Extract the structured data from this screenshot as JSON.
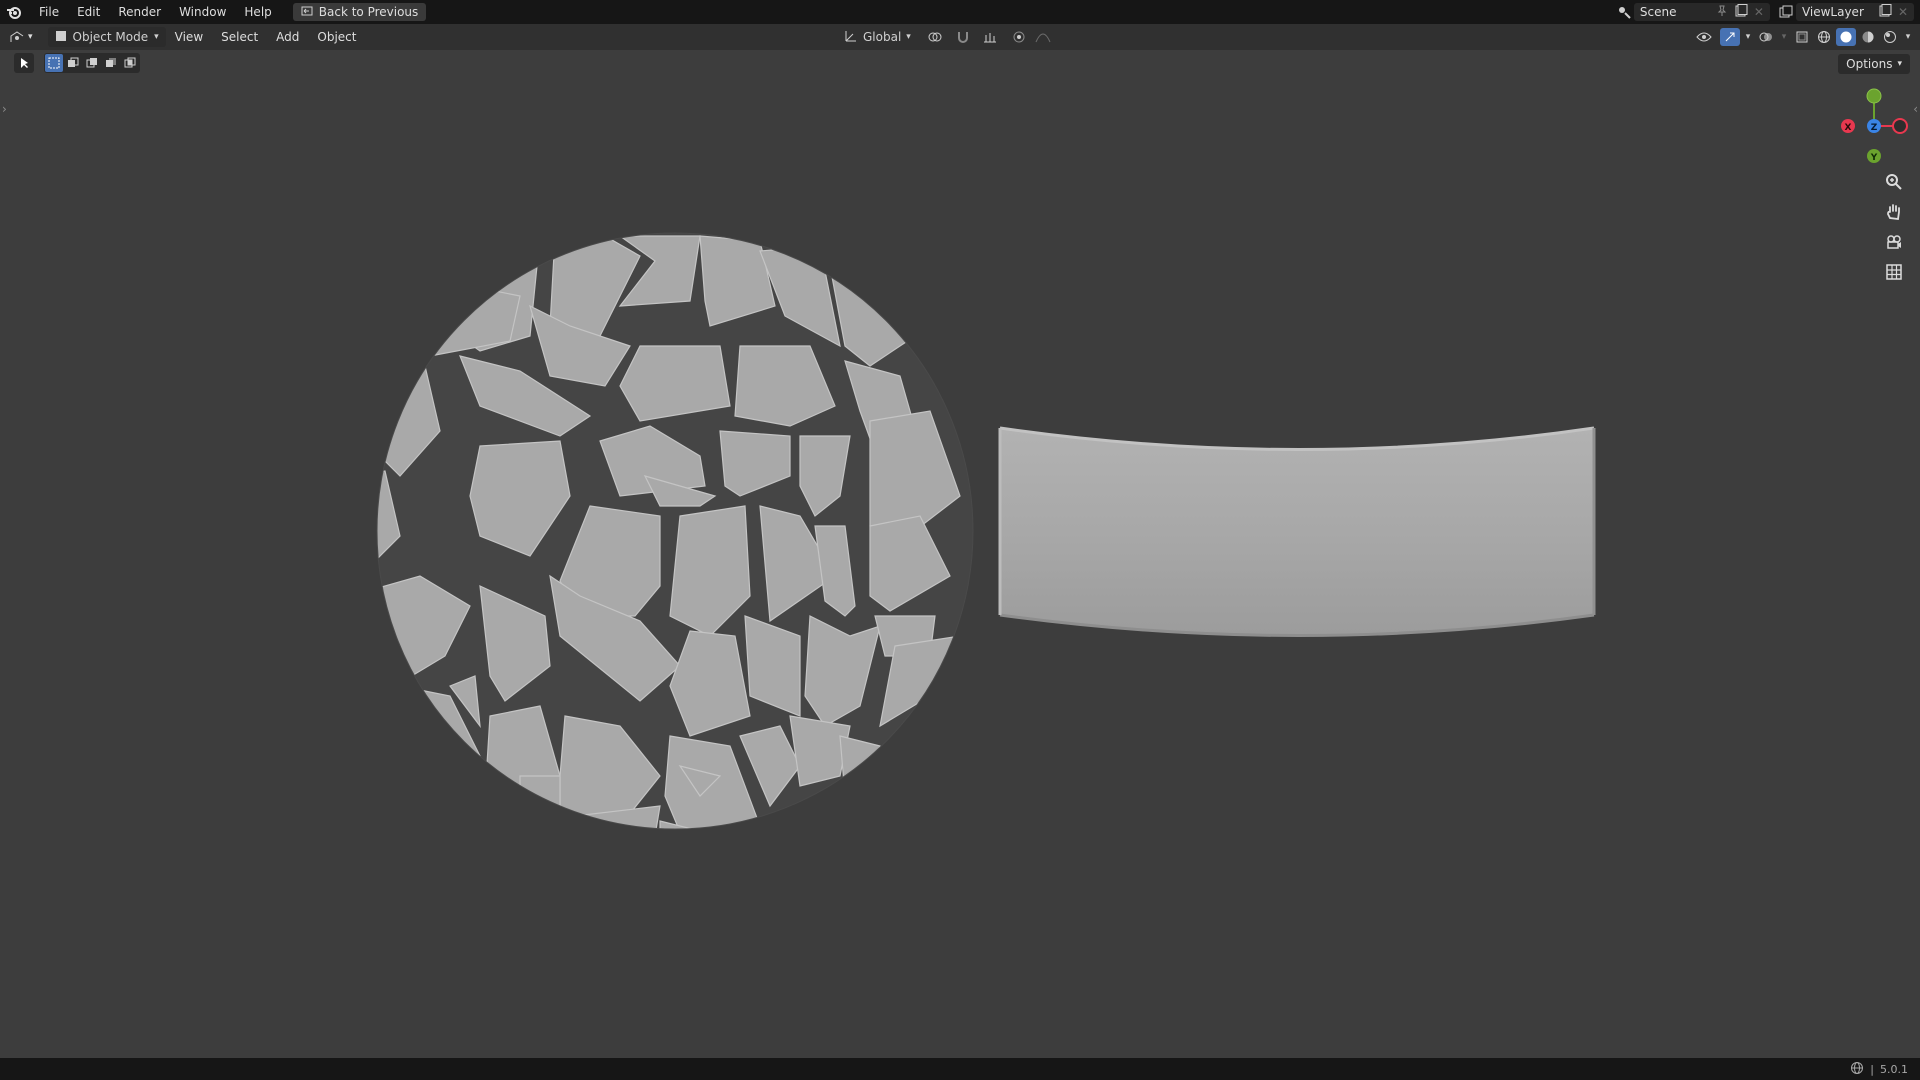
{
  "menu": {
    "file": "File",
    "edit": "Edit",
    "render": "Render",
    "window": "Window",
    "help": "Help",
    "back_to_previous": "Back to Previous"
  },
  "scene": {
    "label": "Scene"
  },
  "view_layer": {
    "label": "ViewLayer"
  },
  "header": {
    "mode": "Object Mode",
    "view": "View",
    "select": "Select",
    "add": "Add",
    "object": "Object",
    "transform_orientation": "Global"
  },
  "options_label": "Options",
  "gizmo": {
    "x": "X",
    "y": "Y",
    "z": "Z"
  },
  "colors": {
    "accent": "#4772b3",
    "axis_x": "#e8384f",
    "axis_y": "#6ba32e",
    "axis_z": "#3a84e6",
    "background": "#3d3d3d",
    "mesh": "#a8a8a8"
  },
  "icons": {
    "logo": "blender-logo-icon",
    "zoom": "zoom-icon",
    "pan": "hand-icon",
    "camera": "camera-icon",
    "grid": "grid-icon"
  },
  "status": {
    "version": "5.0.1"
  }
}
